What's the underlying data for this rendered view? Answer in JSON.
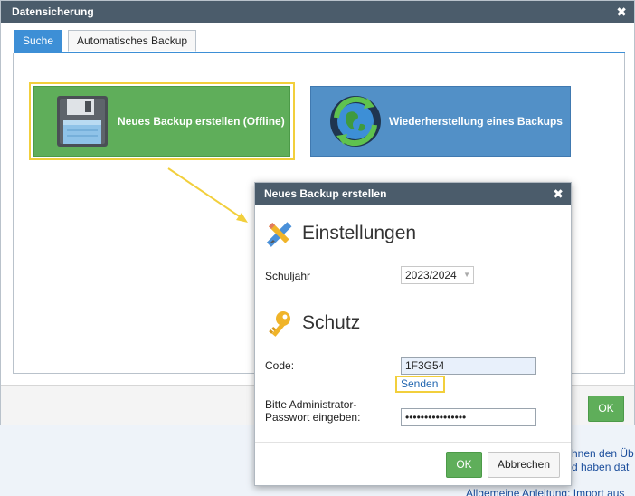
{
  "window": {
    "title": "Datensicherung",
    "close_symbol": "✖",
    "tabs": [
      {
        "label": "Suche",
        "active": true
      },
      {
        "label": "Automatisches Backup",
        "active": false
      }
    ],
    "actions": {
      "create_backup_label": "Neues Backup erstellen (Offline)",
      "create_backup_icon": "floppy-disk-icon",
      "restore_backup_label": "Wiederherstellung eines Backups",
      "restore_backup_icon": "globe-refresh-icon"
    },
    "ok_label": "OK"
  },
  "background_page": {
    "line1": "hnen den Üb",
    "line2": "d haben dat",
    "line3": "Allgemeine Anleitung: Import aus"
  },
  "dialog": {
    "title": "Neues Backup erstellen",
    "close_symbol": "✖",
    "settings": {
      "heading": "Einstellungen",
      "icon": "pencil-ruler-icon",
      "schuljahr_label": "Schuljahr",
      "schuljahr_value": "2023/2024"
    },
    "protection": {
      "heading": "Schutz",
      "icon": "key-icon",
      "code_label": "Code:",
      "code_value": "1F3G54",
      "send_link": "Senden",
      "password_label_line1": "Bitte Administrator-",
      "password_label_line2": "Passwort eingeben:",
      "password_mask": "••••••••••••••••"
    },
    "ok_label": "OK",
    "cancel_label": "Abbrechen"
  },
  "colors": {
    "title_bar": "#4b5c6b",
    "tab_active": "#3d8fd6",
    "green_button": "#5fae5a",
    "blue_button": "#5290c7",
    "highlight": "#f2cf3c",
    "link": "#2166b0"
  }
}
